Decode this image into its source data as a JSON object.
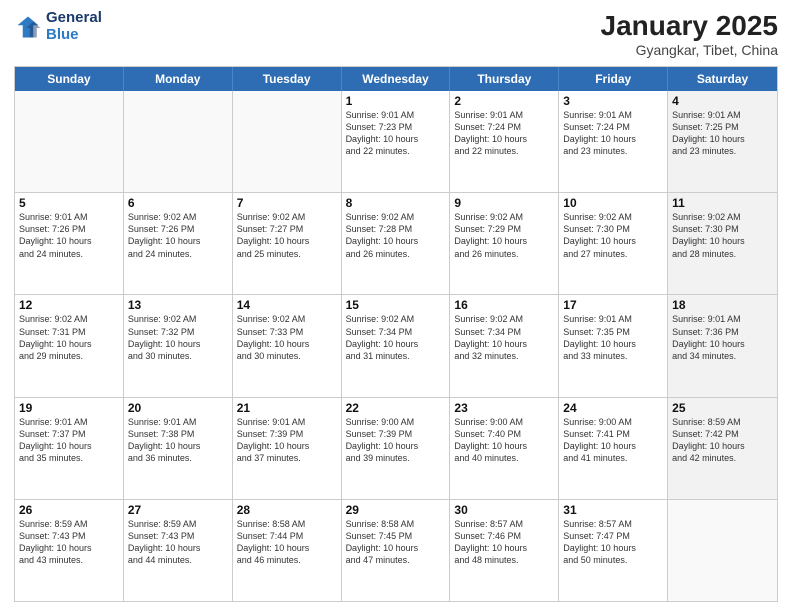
{
  "header": {
    "logo_line1": "General",
    "logo_line2": "Blue",
    "month": "January 2025",
    "location": "Gyangkar, Tibet, China"
  },
  "days_of_week": [
    "Sunday",
    "Monday",
    "Tuesday",
    "Wednesday",
    "Thursday",
    "Friday",
    "Saturday"
  ],
  "weeks": [
    [
      {
        "day": "",
        "info": "",
        "shaded": false,
        "empty": true
      },
      {
        "day": "",
        "info": "",
        "shaded": false,
        "empty": true
      },
      {
        "day": "",
        "info": "",
        "shaded": false,
        "empty": true
      },
      {
        "day": "1",
        "info": "Sunrise: 9:01 AM\nSunset: 7:23 PM\nDaylight: 10 hours\nand 22 minutes.",
        "shaded": false
      },
      {
        "day": "2",
        "info": "Sunrise: 9:01 AM\nSunset: 7:24 PM\nDaylight: 10 hours\nand 22 minutes.",
        "shaded": false
      },
      {
        "day": "3",
        "info": "Sunrise: 9:01 AM\nSunset: 7:24 PM\nDaylight: 10 hours\nand 23 minutes.",
        "shaded": false
      },
      {
        "day": "4",
        "info": "Sunrise: 9:01 AM\nSunset: 7:25 PM\nDaylight: 10 hours\nand 23 minutes.",
        "shaded": true
      }
    ],
    [
      {
        "day": "5",
        "info": "Sunrise: 9:01 AM\nSunset: 7:26 PM\nDaylight: 10 hours\nand 24 minutes.",
        "shaded": false
      },
      {
        "day": "6",
        "info": "Sunrise: 9:02 AM\nSunset: 7:26 PM\nDaylight: 10 hours\nand 24 minutes.",
        "shaded": false
      },
      {
        "day": "7",
        "info": "Sunrise: 9:02 AM\nSunset: 7:27 PM\nDaylight: 10 hours\nand 25 minutes.",
        "shaded": false
      },
      {
        "day": "8",
        "info": "Sunrise: 9:02 AM\nSunset: 7:28 PM\nDaylight: 10 hours\nand 26 minutes.",
        "shaded": false
      },
      {
        "day": "9",
        "info": "Sunrise: 9:02 AM\nSunset: 7:29 PM\nDaylight: 10 hours\nand 26 minutes.",
        "shaded": false
      },
      {
        "day": "10",
        "info": "Sunrise: 9:02 AM\nSunset: 7:30 PM\nDaylight: 10 hours\nand 27 minutes.",
        "shaded": false
      },
      {
        "day": "11",
        "info": "Sunrise: 9:02 AM\nSunset: 7:30 PM\nDaylight: 10 hours\nand 28 minutes.",
        "shaded": true
      }
    ],
    [
      {
        "day": "12",
        "info": "Sunrise: 9:02 AM\nSunset: 7:31 PM\nDaylight: 10 hours\nand 29 minutes.",
        "shaded": false
      },
      {
        "day": "13",
        "info": "Sunrise: 9:02 AM\nSunset: 7:32 PM\nDaylight: 10 hours\nand 30 minutes.",
        "shaded": false
      },
      {
        "day": "14",
        "info": "Sunrise: 9:02 AM\nSunset: 7:33 PM\nDaylight: 10 hours\nand 30 minutes.",
        "shaded": false
      },
      {
        "day": "15",
        "info": "Sunrise: 9:02 AM\nSunset: 7:34 PM\nDaylight: 10 hours\nand 31 minutes.",
        "shaded": false
      },
      {
        "day": "16",
        "info": "Sunrise: 9:02 AM\nSunset: 7:34 PM\nDaylight: 10 hours\nand 32 minutes.",
        "shaded": false
      },
      {
        "day": "17",
        "info": "Sunrise: 9:01 AM\nSunset: 7:35 PM\nDaylight: 10 hours\nand 33 minutes.",
        "shaded": false
      },
      {
        "day": "18",
        "info": "Sunrise: 9:01 AM\nSunset: 7:36 PM\nDaylight: 10 hours\nand 34 minutes.",
        "shaded": true
      }
    ],
    [
      {
        "day": "19",
        "info": "Sunrise: 9:01 AM\nSunset: 7:37 PM\nDaylight: 10 hours\nand 35 minutes.",
        "shaded": false
      },
      {
        "day": "20",
        "info": "Sunrise: 9:01 AM\nSunset: 7:38 PM\nDaylight: 10 hours\nand 36 minutes.",
        "shaded": false
      },
      {
        "day": "21",
        "info": "Sunrise: 9:01 AM\nSunset: 7:39 PM\nDaylight: 10 hours\nand 37 minutes.",
        "shaded": false
      },
      {
        "day": "22",
        "info": "Sunrise: 9:00 AM\nSunset: 7:39 PM\nDaylight: 10 hours\nand 39 minutes.",
        "shaded": false
      },
      {
        "day": "23",
        "info": "Sunrise: 9:00 AM\nSunset: 7:40 PM\nDaylight: 10 hours\nand 40 minutes.",
        "shaded": false
      },
      {
        "day": "24",
        "info": "Sunrise: 9:00 AM\nSunset: 7:41 PM\nDaylight: 10 hours\nand 41 minutes.",
        "shaded": false
      },
      {
        "day": "25",
        "info": "Sunrise: 8:59 AM\nSunset: 7:42 PM\nDaylight: 10 hours\nand 42 minutes.",
        "shaded": true
      }
    ],
    [
      {
        "day": "26",
        "info": "Sunrise: 8:59 AM\nSunset: 7:43 PM\nDaylight: 10 hours\nand 43 minutes.",
        "shaded": false
      },
      {
        "day": "27",
        "info": "Sunrise: 8:59 AM\nSunset: 7:43 PM\nDaylight: 10 hours\nand 44 minutes.",
        "shaded": false
      },
      {
        "day": "28",
        "info": "Sunrise: 8:58 AM\nSunset: 7:44 PM\nDaylight: 10 hours\nand 46 minutes.",
        "shaded": false
      },
      {
        "day": "29",
        "info": "Sunrise: 8:58 AM\nSunset: 7:45 PM\nDaylight: 10 hours\nand 47 minutes.",
        "shaded": false
      },
      {
        "day": "30",
        "info": "Sunrise: 8:57 AM\nSunset: 7:46 PM\nDaylight: 10 hours\nand 48 minutes.",
        "shaded": false
      },
      {
        "day": "31",
        "info": "Sunrise: 8:57 AM\nSunset: 7:47 PM\nDaylight: 10 hours\nand 50 minutes.",
        "shaded": false
      },
      {
        "day": "",
        "info": "",
        "shaded": true,
        "empty": true
      }
    ]
  ]
}
